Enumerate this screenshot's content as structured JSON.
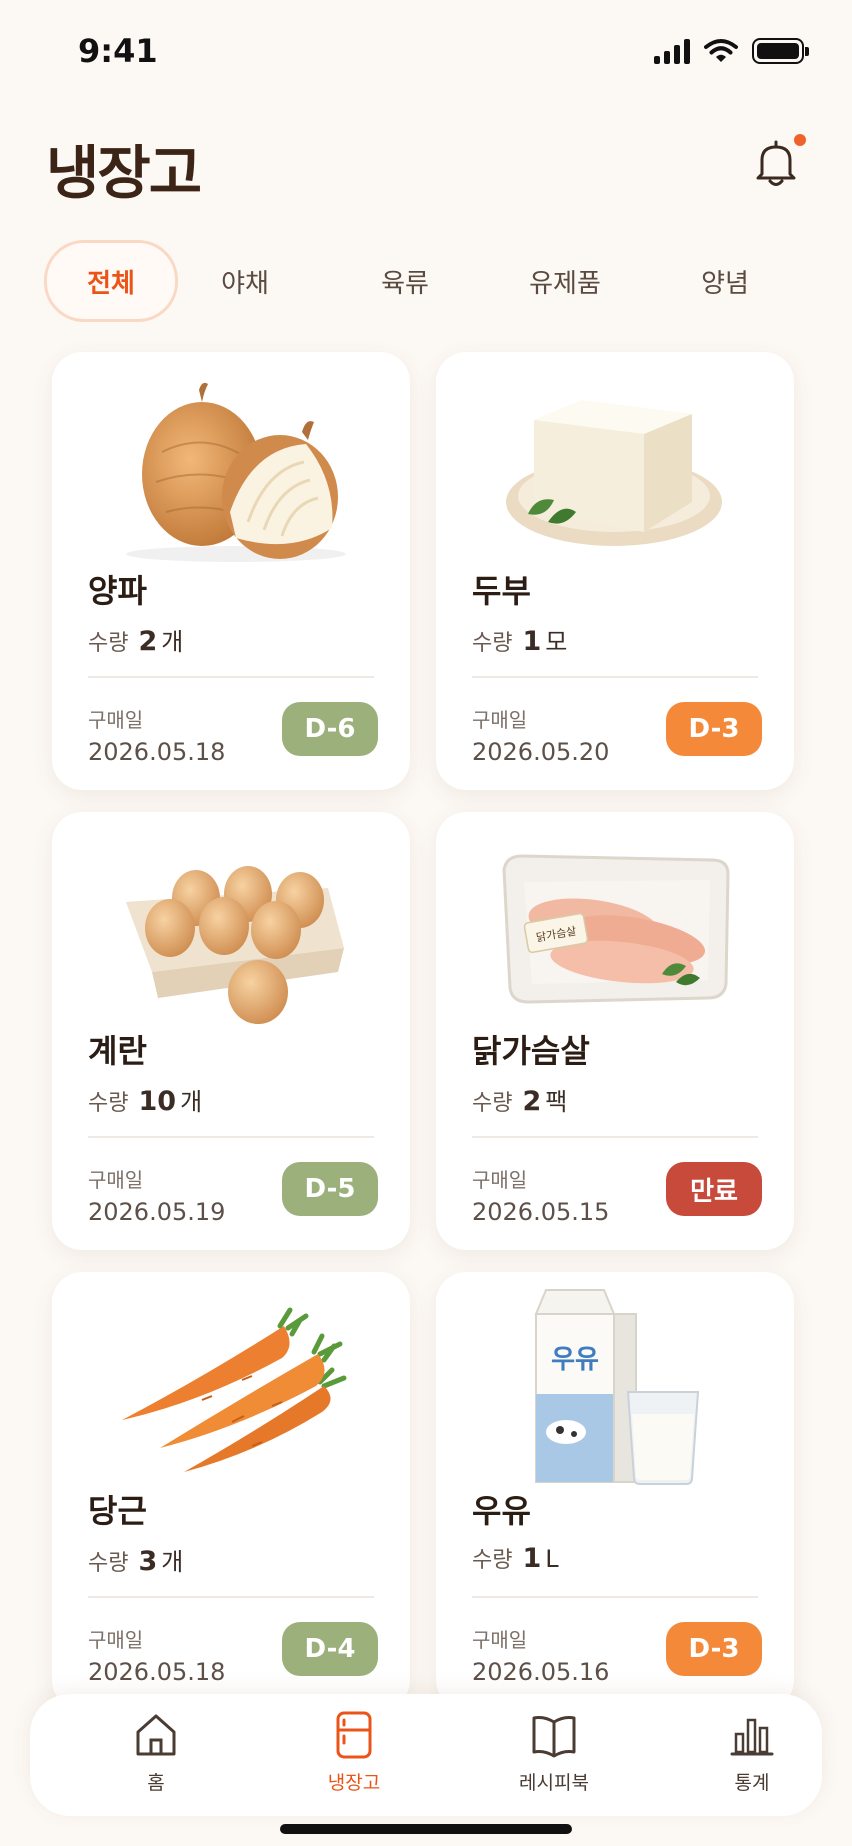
{
  "status_bar": {
    "time": "9:41"
  },
  "header": {
    "title": "냉장고"
  },
  "tabs": [
    {
      "label": "전체",
      "active": true
    },
    {
      "label": "야채"
    },
    {
      "label": "육류"
    },
    {
      "label": "유제품"
    },
    {
      "label": "양념"
    }
  ],
  "items": [
    {
      "name": "양파",
      "qty_label": "수량",
      "qty": "2",
      "unit": "개",
      "buy_label": "구매일",
      "date": "2026.05.18",
      "badge": "D-6",
      "badge_color": "#9cb07c",
      "icon": "onion-icon"
    },
    {
      "name": "두부",
      "qty_label": "수량",
      "qty": "1",
      "unit": "모",
      "buy_label": "구매일",
      "date": "2026.05.20",
      "badge": "D-3",
      "badge_color": "#f4893a",
      "icon": "tofu-icon"
    },
    {
      "name": "계란",
      "qty_label": "수량",
      "qty": "10",
      "unit": "개",
      "buy_label": "구매일",
      "date": "2026.05.19",
      "badge": "D-5",
      "badge_color": "#9cb07c",
      "icon": "eggs-icon"
    },
    {
      "name": "닭가슴살",
      "qty_label": "수량",
      "qty": "2",
      "unit": "팩",
      "buy_label": "구매일",
      "date": "2026.05.15",
      "badge": "만료",
      "badge_color": "#c84a3a",
      "icon": "chicken-breast-icon",
      "package_label": "닭가슴살"
    },
    {
      "name": "당근",
      "qty_label": "수량",
      "qty": "3",
      "unit": "개",
      "buy_label": "구매일",
      "date": "2026.05.18",
      "badge": "D-4",
      "badge_color": "#9cb07c",
      "icon": "carrot-icon"
    },
    {
      "name": "우유",
      "qty_label": "수량",
      "qty": "1",
      "unit": "L",
      "buy_label": "구매일",
      "date": "2026.05.16",
      "badge": "D-3",
      "badge_color": "#f4893a",
      "icon": "milk-icon",
      "package_label": "우유"
    }
  ],
  "nav": [
    {
      "label": "홈",
      "icon": "home-icon"
    },
    {
      "label": "냉장고",
      "icon": "fridge-icon",
      "active": true
    },
    {
      "label": "레시피북",
      "icon": "book-icon"
    },
    {
      "label": "통계",
      "icon": "bar-chart-icon"
    }
  ],
  "colors": {
    "accent": "#ea5418",
    "background": "#fcf8f4",
    "fresh": "#9cb07c",
    "soon": "#f4893a",
    "expired": "#c84a3a"
  }
}
